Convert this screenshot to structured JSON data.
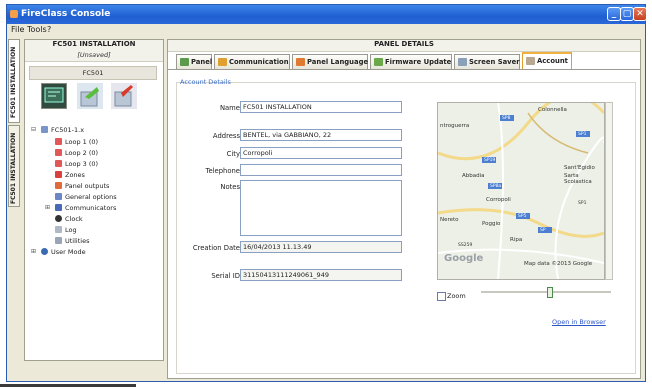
{
  "window": {
    "title": "FireClass Console",
    "controls": {
      "minimize": "_",
      "restore": "▢",
      "close": "✕"
    }
  },
  "menu": [
    "File",
    "Tools",
    "?"
  ],
  "side_tabs": [
    "FC501 INSTALLATION",
    "FC501 INSTALLATION"
  ],
  "left_panel": {
    "title": "FC501 INSTALLATION",
    "subtitle": "[Unsaved]",
    "group": "FC501",
    "icons": [
      "panel-monitor-icon",
      "upload-panel-icon",
      "download-panel-icon"
    ],
    "tree": [
      {
        "label": "FC501-1.x",
        "expander": "⊟"
      },
      {
        "label": "Loop 1 (0)"
      },
      {
        "label": "Loop 2 (0)"
      },
      {
        "label": "Loop 3 (0)"
      },
      {
        "label": "Zones"
      },
      {
        "label": "Panel outputs"
      },
      {
        "label": "General options"
      },
      {
        "label": "Communicators",
        "expander": "⊞"
      },
      {
        "label": "Clock"
      },
      {
        "label": "Log"
      },
      {
        "label": "Utilities"
      },
      {
        "label": "User Mode",
        "expander": "⊞"
      }
    ]
  },
  "right_panel": {
    "title": "PANEL DETAILS",
    "tabs": [
      "Panel",
      "Communication",
      "Panel Language",
      "Firmware Update",
      "Screen Saver",
      "Account"
    ],
    "active_tab": "Account",
    "section": "Account Details",
    "fields": {
      "name": {
        "label": "Name",
        "value": "FC501 INSTALLATION"
      },
      "address": {
        "label": "Address",
        "value": "BENTEL, via GABBIANO, 22"
      },
      "city": {
        "label": "City",
        "value": "Corropoli"
      },
      "telephone": {
        "label": "Telephone",
        "value": ""
      },
      "notes": {
        "label": "Notes",
        "value": ""
      },
      "creation_date": {
        "label": "Creation Date",
        "value": "16/04/2013 11.13.49"
      },
      "serial_id": {
        "label": "Serial ID",
        "value": "31150413111249061_949"
      }
    },
    "map": {
      "places": [
        "ntroguerra",
        "Colonnella",
        "SP8",
        "SP1",
        "SP19",
        "Sant'Egidio",
        "SP8a",
        "Abbadia",
        "SP5",
        "Corropoli",
        "Nereto",
        "Poggio",
        "SP",
        "Sarta Scolastica",
        "SP1",
        "Ripa",
        "SS259"
      ],
      "provider": "Google",
      "copyright": "Map data ©2013 Google"
    },
    "zoom": {
      "label": "Zoom",
      "checked": false,
      "level": 0.53
    },
    "open_in_browser": "Open in Browser"
  }
}
